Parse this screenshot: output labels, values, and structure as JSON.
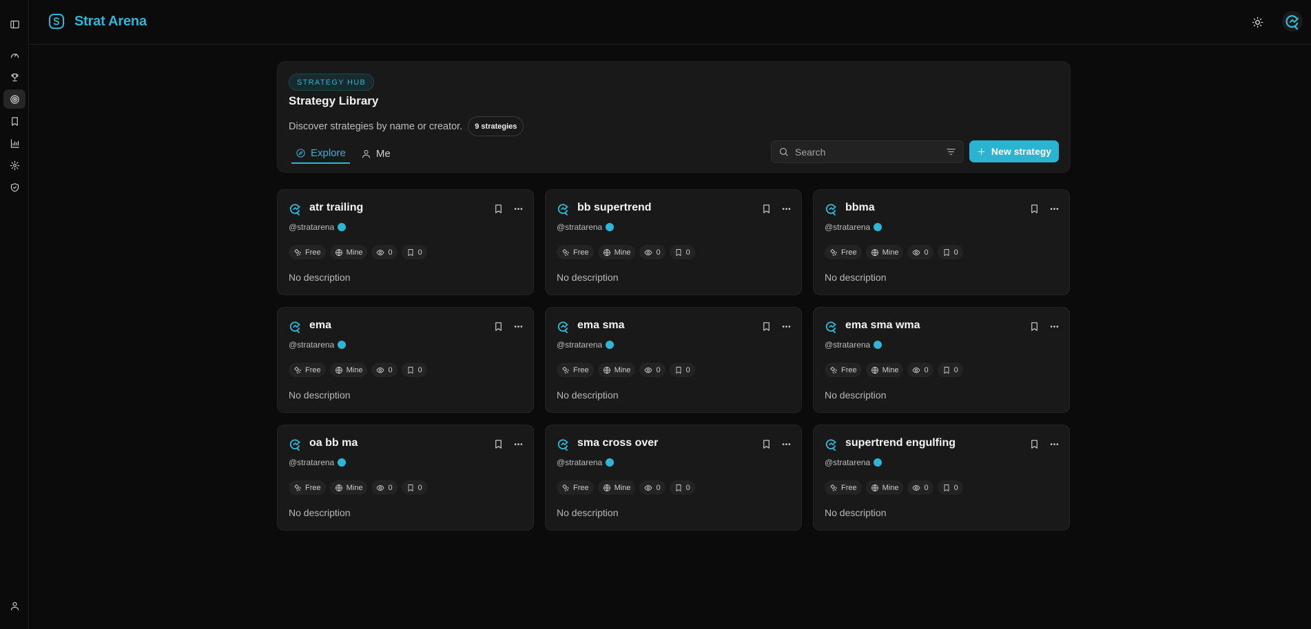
{
  "app": {
    "name": "Strat Arena",
    "accent": "#2fb6d6"
  },
  "hub": {
    "badge": "STRATEGY HUB",
    "title": "Strategy Library",
    "description": "Discover strategies by name or creator.",
    "count": "9 strategies",
    "tabs": [
      {
        "label": "Explore",
        "icon": "compass-icon",
        "active": true
      },
      {
        "label": "Me",
        "icon": "user-icon",
        "active": false
      }
    ],
    "search_placeholder": "Search",
    "new_button": "New strategy"
  },
  "cards": [
    {
      "title": "atr trailing",
      "author": "@stratarena",
      "price": "Free",
      "visibility": "Mine",
      "views": "0",
      "saves": "0",
      "description": "No description"
    },
    {
      "title": "bb supertrend",
      "author": "@stratarena",
      "price": "Free",
      "visibility": "Mine",
      "views": "0",
      "saves": "0",
      "description": "No description"
    },
    {
      "title": "bbma",
      "author": "@stratarena",
      "price": "Free",
      "visibility": "Mine",
      "views": "0",
      "saves": "0",
      "description": "No description"
    },
    {
      "title": "ema",
      "author": "@stratarena",
      "price": "Free",
      "visibility": "Mine",
      "views": "0",
      "saves": "0",
      "description": "No description"
    },
    {
      "title": "ema sma",
      "author": "@stratarena",
      "price": "Free",
      "visibility": "Mine",
      "views": "0",
      "saves": "0",
      "description": "No description"
    },
    {
      "title": "ema sma wma",
      "author": "@stratarena",
      "price": "Free",
      "visibility": "Mine",
      "views": "0",
      "saves": "0",
      "description": "No description"
    },
    {
      "title": "oa bb ma",
      "author": "@stratarena",
      "price": "Free",
      "visibility": "Mine",
      "views": "0",
      "saves": "0",
      "description": "No description"
    },
    {
      "title": "sma cross over",
      "author": "@stratarena",
      "price": "Free",
      "visibility": "Mine",
      "views": "0",
      "saves": "0",
      "description": "No description"
    },
    {
      "title": "supertrend engulfing",
      "author": "@stratarena",
      "price": "Free",
      "visibility": "Mine",
      "views": "0",
      "saves": "0",
      "description": "No description"
    }
  ]
}
